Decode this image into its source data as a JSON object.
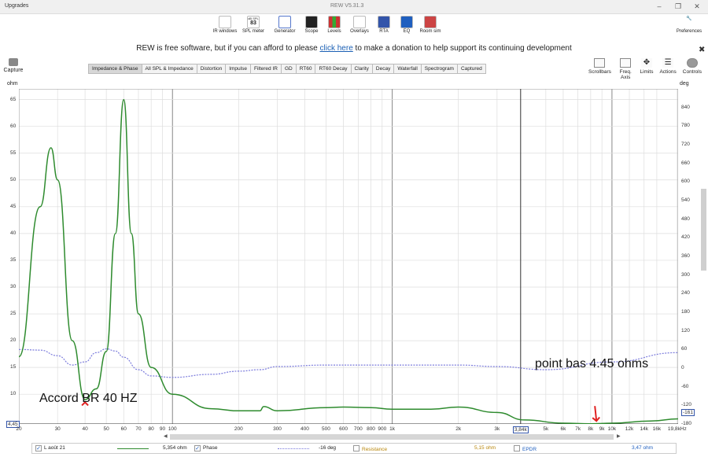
{
  "window": {
    "menu": "Upgrades",
    "title": "REW V5.31.3"
  },
  "toolbar": {
    "items": [
      "IR windows",
      "SPL meter",
      "Generator",
      "Scope",
      "Levels",
      "Overlays",
      "RTA",
      "EQ",
      "Room sim"
    ],
    "spl_value": "83",
    "spl_badge": "dB SPL",
    "preferences": "Preferences"
  },
  "donate": {
    "before": "REW is free software, but if you can afford to please ",
    "link": "click here",
    "after": " to make a donation to help support its continuing development"
  },
  "capture": "Capture",
  "tabs": [
    {
      "label": "Impedance & Phase",
      "active": true
    },
    {
      "label": "All SPL & Impedance"
    },
    {
      "label": "Distortion"
    },
    {
      "label": "Impulse"
    },
    {
      "label": "Filtered IR"
    },
    {
      "label": "GD"
    },
    {
      "label": "RT60"
    },
    {
      "label": "RT60 Decay"
    },
    {
      "label": "Clarity"
    },
    {
      "label": "Decay"
    },
    {
      "label": "Waterfall"
    },
    {
      "label": "Spectrogram"
    },
    {
      "label": "Captured"
    }
  ],
  "controls": [
    "Scrollbars",
    "Freq. Axis",
    "Limits",
    "Actions",
    "Controls"
  ],
  "chart_data": {
    "type": "line",
    "ylabel_left": "ohm",
    "ylabel_right": "deg",
    "xscale": "log",
    "xlim": [
      20,
      20000
    ],
    "ylim_left": [
      4.45,
      67
    ],
    "ylim_right": [
      -180,
      900
    ],
    "x_ticks": [
      "20",
      "30",
      "40",
      "50",
      "60",
      "70",
      "80",
      "90",
      "100",
      "200",
      "300",
      "400",
      "500",
      "600",
      "700",
      "800",
      "900",
      "1k",
      "2k",
      "3k",
      "3,84k",
      "5k",
      "6k",
      "7k",
      "8k",
      "9k",
      "10k",
      "12k",
      "14k",
      "16k",
      "19,8kHz"
    ],
    "y_ticks_left": [
      "65",
      "60",
      "55",
      "50",
      "45",
      "40",
      "35",
      "30",
      "25",
      "20",
      "15",
      "10",
      "4,45"
    ],
    "y_ticks_right": [
      "840",
      "780",
      "720",
      "660",
      "600",
      "540",
      "480",
      "420",
      "360",
      "300",
      "240",
      "180",
      "120",
      "60",
      "0",
      "-60",
      "-120",
      "-180",
      "-161"
    ],
    "cursor_x": "3,84k",
    "cursor_y_left": "4,45",
    "cursor_y_right": "-161",
    "series": [
      {
        "name": "L août 21",
        "color": "#2e8b2e",
        "x": [
          20,
          25,
          28,
          30,
          35,
          40,
          45,
          50,
          55,
          60,
          65,
          70,
          80,
          100,
          150,
          200,
          250,
          260,
          300,
          500,
          600,
          800,
          1000,
          1500,
          2000,
          3000,
          4000,
          6000,
          8000,
          10000,
          15000,
          20000
        ],
        "y": [
          17,
          45,
          56,
          50,
          20,
          9,
          11,
          18,
          40,
          65,
          40,
          25,
          15,
          10,
          7.3,
          6.9,
          6.9,
          7.7,
          6.9,
          7.5,
          7.6,
          7.5,
          7.2,
          7.2,
          7.6,
          6.6,
          5.2,
          4.6,
          4.5,
          4.6,
          5.0,
          5.4
        ]
      },
      {
        "name": "Phase",
        "color": "#7b7bdc",
        "dashed": true,
        "x": [
          20,
          25,
          30,
          35,
          40,
          45,
          50,
          55,
          60,
          70,
          80,
          100,
          150,
          200,
          250,
          300,
          500,
          1000,
          2000,
          3000,
          5000,
          10000,
          20000
        ],
        "y": [
          60,
          58,
          40,
          10,
          20,
          50,
          62,
          55,
          35,
          -5,
          -25,
          -30,
          -20,
          -10,
          -5,
          5,
          10,
          10,
          10,
          5,
          -5,
          20,
          50
        ]
      }
    ],
    "annotations": [
      "Accord BR 40 HZ",
      "point bas 4.45 ohms"
    ]
  },
  "legend": {
    "name": "L août 21",
    "value": "5,354 ohm",
    "phase": "Phase",
    "phase_value": "-16 deg",
    "resistance": "Resistance",
    "resistance_value": "5,15 ohm",
    "epdr": "EPDR",
    "epdr_value": "3,47 ohm"
  }
}
